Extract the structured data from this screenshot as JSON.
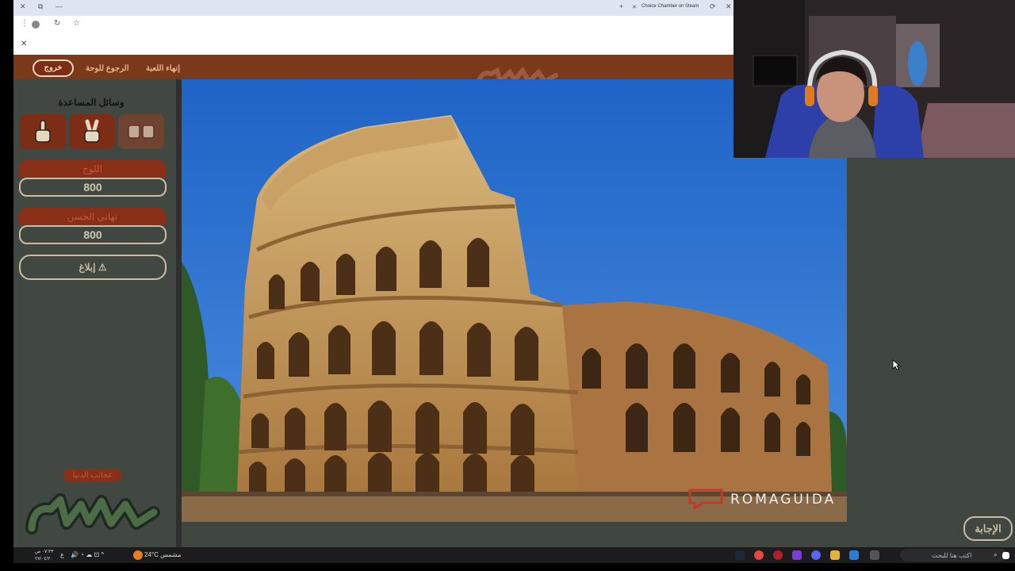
{
  "browser": {
    "tab_title": "Choice Chamber on Steam",
    "new_tab": "+",
    "tab_close": "✕"
  },
  "topbar": {
    "exit_label": "خروج",
    "back_to_board_label": "الرجوع للوحة",
    "end_game_label": "إنهاء اللعبة"
  },
  "sidebar": {
    "help_title": "وسائل المساعدة",
    "teams": [
      {
        "name": "اللوج",
        "score": "800"
      },
      {
        "name": "نهاني الحسن",
        "score": "800"
      }
    ],
    "report_label": "إبلاغ ⚠",
    "category": "عجائب الدنيا"
  },
  "main": {
    "watermark": "ROMAGUIDA",
    "answer_label": "الإجابة"
  },
  "taskbar": {
    "search_placeholder": "اكتب هنا للبحث",
    "weather": "24°C مشمس",
    "clock_time": "٠٧:٣٣ ص",
    "clock_date": "٢٧/٠٤/٢٠",
    "lang": "ع"
  },
  "colors": {
    "brand_red": "#7d2d15",
    "panel_green": "#414842",
    "cream": "#cbbca4"
  }
}
